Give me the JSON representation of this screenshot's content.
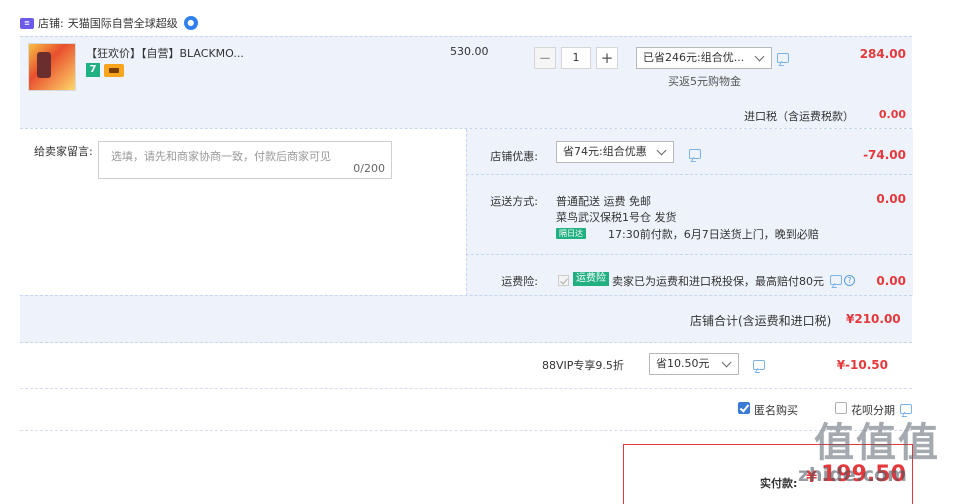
{
  "store": {
    "label": "店铺:",
    "name": "天猫国际自营全球超级",
    "icon": "store-icon",
    "badge_icon": "official-badge-icon"
  },
  "item": {
    "title": "【狂欢价】【自营】BLACKMO...",
    "tag_number": "7",
    "unit_price": "530.00",
    "quantity": "1",
    "minus_label": "−",
    "plus_label": "+",
    "discount_option": "已省246元:组合优...",
    "rebate_text": "买返5元购物金",
    "total": "284.00"
  },
  "tax": {
    "label": "进口税（含运费税款）",
    "value": "0.00"
  },
  "message": {
    "label": "给卖家留言:",
    "placeholder": "选填，请先和商家协商一致，付款后商家可见",
    "count": "0/200"
  },
  "coupon": {
    "label": "店铺优惠:",
    "option": "省74元:组合优惠",
    "value": "-74.00"
  },
  "shipping": {
    "label": "运送方式:",
    "line1": "普通配送 运费 免邮",
    "line2": "菜鸟武汉保税1号仓  发货",
    "badge": "隔日达",
    "line3": "17:30前付款，6月7日送货上门，晚到必赔",
    "value": "0.00"
  },
  "insurance": {
    "label": "运费险:",
    "badge": "运费险",
    "text": "卖家已为运费和进口税投保，最高赔付80元",
    "value": "0.00"
  },
  "subtotal": {
    "label": "店铺合计(含运费和进口税)",
    "value": "¥210.00"
  },
  "vip": {
    "label": "88VIP专享9.5折",
    "option": "省10.50元",
    "value": "¥-10.50"
  },
  "options": {
    "anonymous_label": "匿名购买",
    "anonymous_checked": true,
    "huabei_label": "花呗分期",
    "huabei_checked": false
  },
  "payment": {
    "label": "实付款:",
    "currency": "¥",
    "value": "199.50"
  },
  "watermark": {
    "text": "值值值",
    "url": "zhide.com"
  },
  "colors": {
    "accent_red": "#e4393c",
    "row_bg": "#eef3fb",
    "green_badge": "#20b082",
    "link_blue": "#3a7bd5"
  }
}
